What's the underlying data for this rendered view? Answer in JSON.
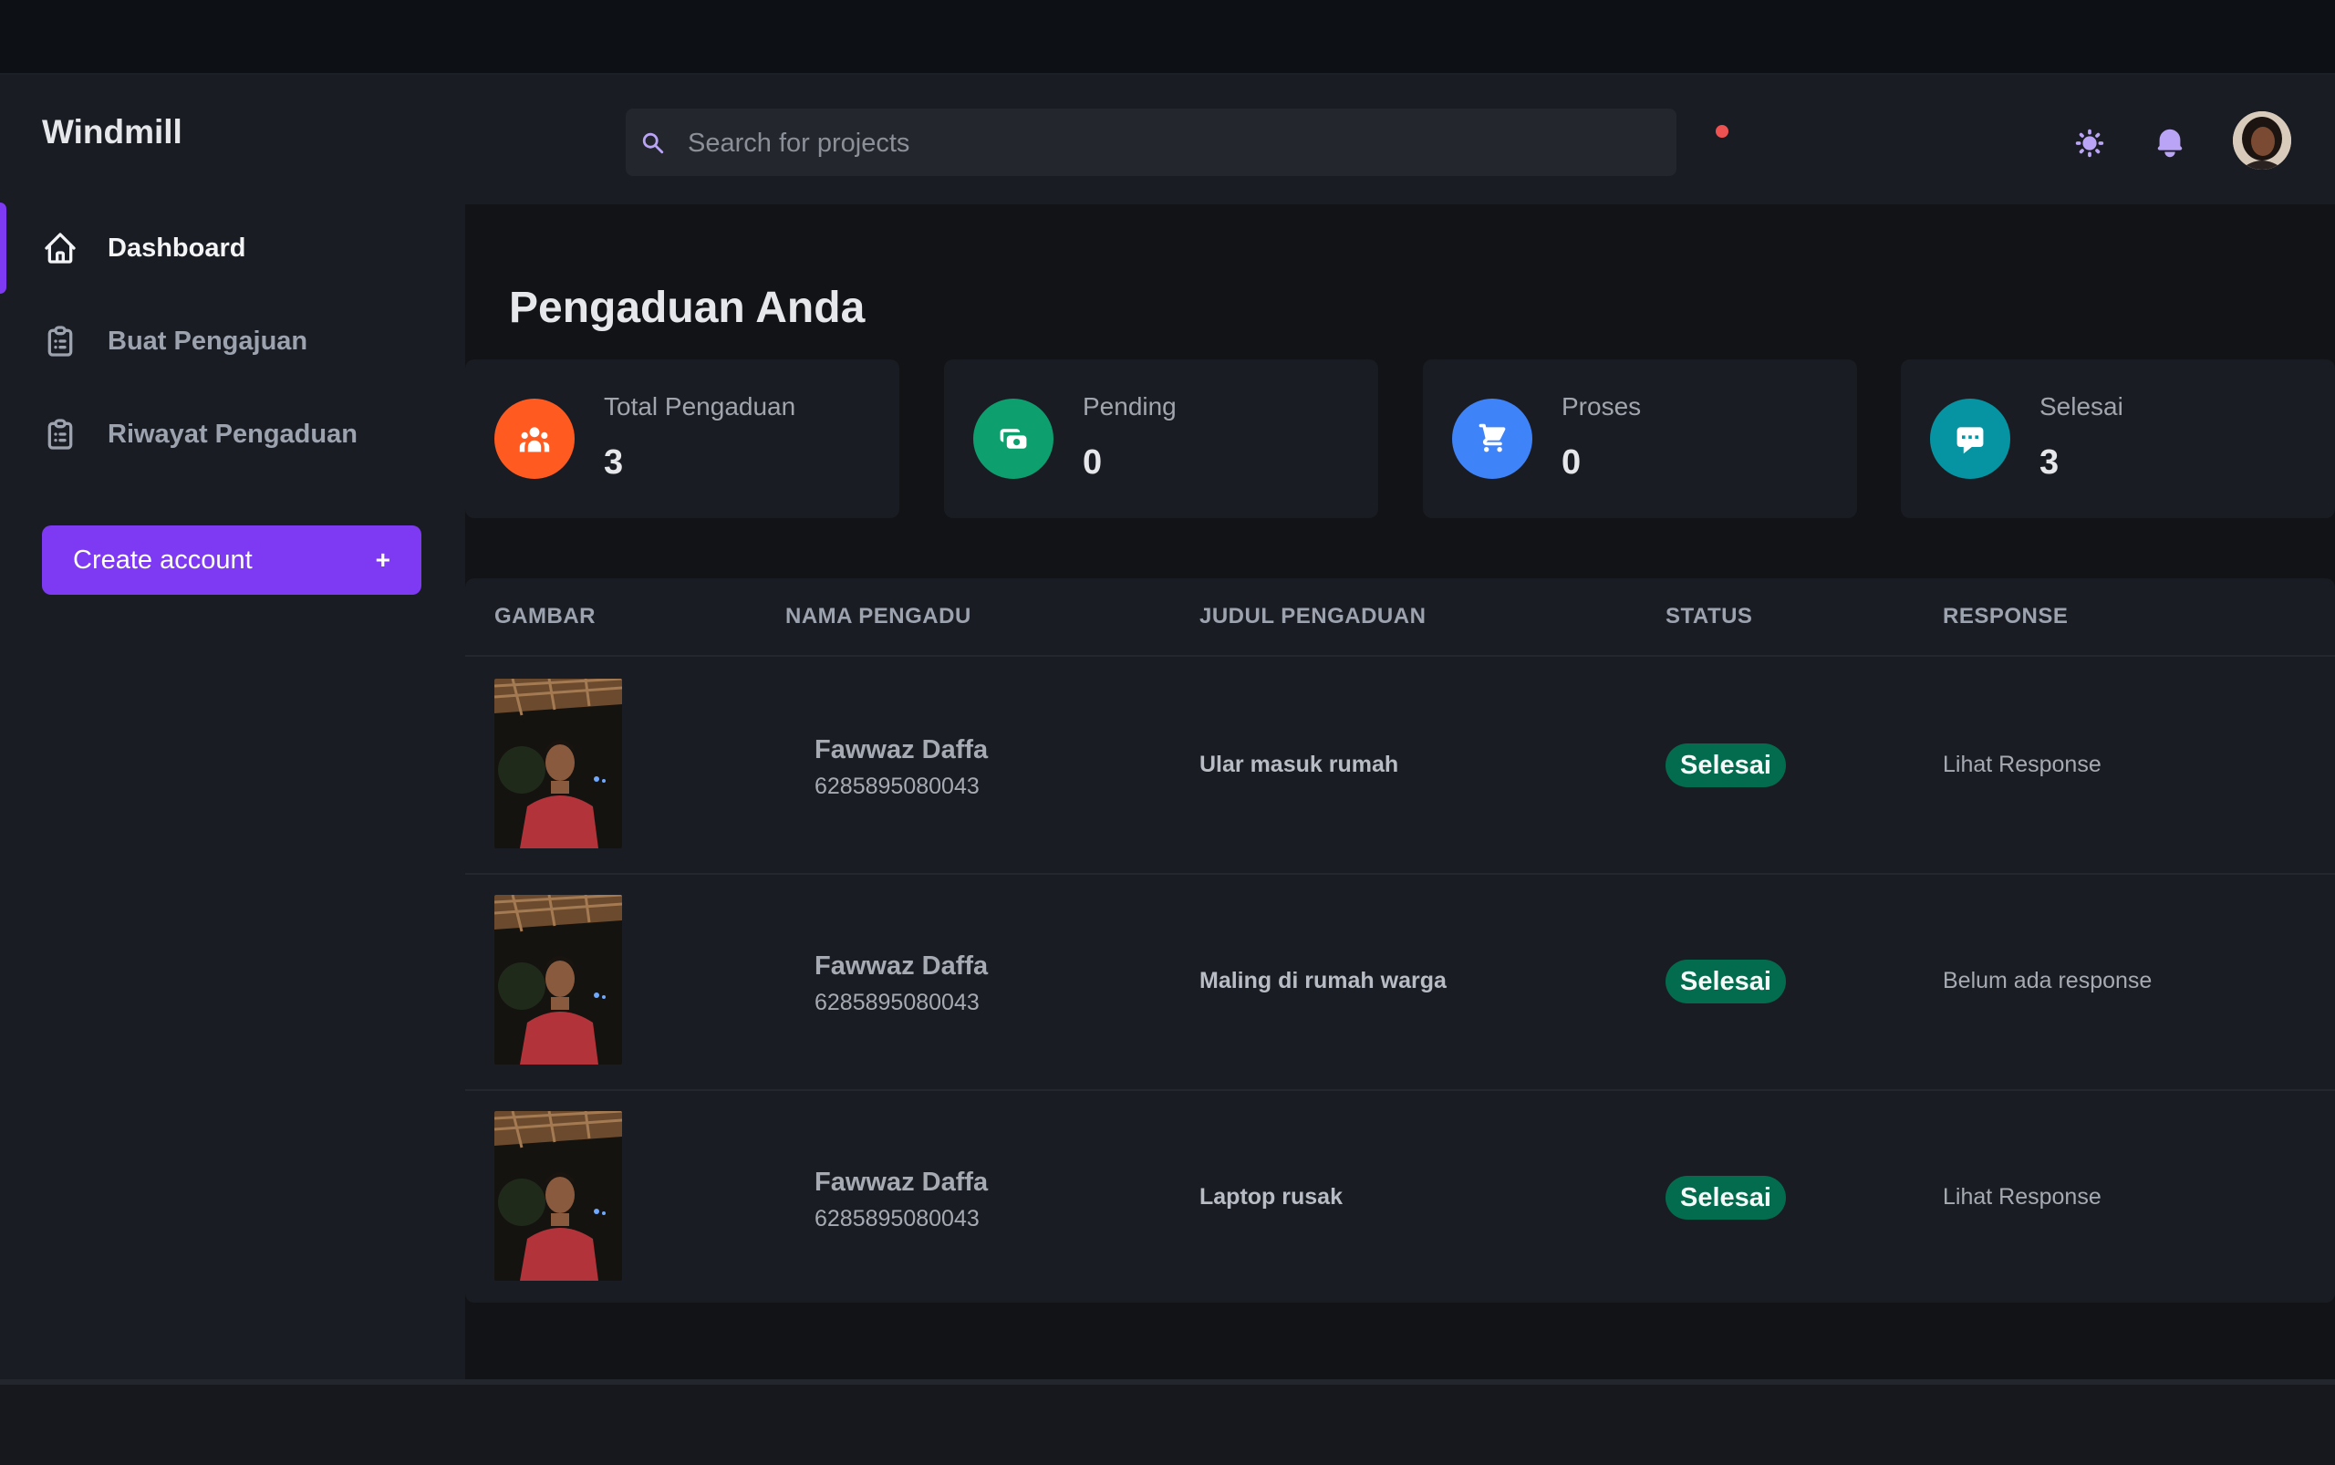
{
  "app": {
    "brand": "Windmill"
  },
  "sidebar": {
    "items": [
      {
        "label": "Dashboard",
        "icon": "home-icon",
        "active": true
      },
      {
        "label": "Buat Pengajuan",
        "icon": "clipboard-icon",
        "active": false
      },
      {
        "label": "Riwayat Pengaduan",
        "icon": "clipboard-icon",
        "active": false
      }
    ],
    "create_button": {
      "label": "Create account",
      "plus": "+"
    }
  },
  "header": {
    "search_placeholder": "Search for projects",
    "icons": [
      "sun-icon",
      "bell-icon",
      "avatar"
    ]
  },
  "page": {
    "title": "Pengaduan Anda"
  },
  "cards": [
    {
      "label": "Total Pengaduan",
      "value": "3",
      "icon": "users-icon",
      "color": "#ff5a1f"
    },
    {
      "label": "Pending",
      "value": "0",
      "icon": "money-icon",
      "color": "#0e9f6e"
    },
    {
      "label": "Proses",
      "value": "0",
      "icon": "cart-icon",
      "color": "#3f83f8"
    },
    {
      "label": "Selesai",
      "value": "3",
      "icon": "chat-icon",
      "color": "#0694a2"
    }
  ],
  "table": {
    "headers": [
      "GAMBAR",
      "NAMA PENGADU",
      "JUDUL PENGADUAN",
      "STATUS",
      "RESPONSE"
    ],
    "rows": [
      {
        "name": "Fawwaz Daffa",
        "phone": "6285895080043",
        "title": "Ular masuk rumah",
        "status": "Selesai",
        "response": "Lihat Response"
      },
      {
        "name": "Fawwaz Daffa",
        "phone": "6285895080043",
        "title": "Maling di rumah warga",
        "status": "Selesai",
        "response": "Belum ada response"
      },
      {
        "name": "Fawwaz Daffa",
        "phone": "6285895080043",
        "title": "Laptop rusak",
        "status": "Selesai",
        "response": "Lihat Response"
      }
    ]
  },
  "colors": {
    "accent": "#7e3af2",
    "status_done": "#046c4e",
    "notification": "#f05252"
  }
}
